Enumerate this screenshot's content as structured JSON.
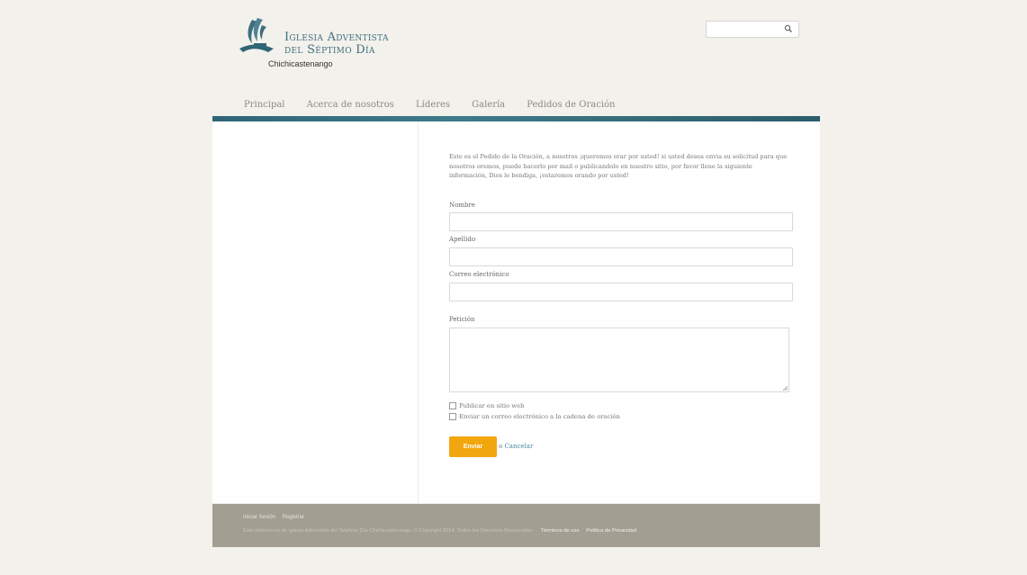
{
  "header": {
    "logo_line1": "Iglesia Adventista",
    "logo_line2": "del Séptimo Día",
    "logo_sub": "Chichicastenango",
    "search_placeholder": "",
    "search_icon": "search-icon"
  },
  "nav": {
    "items": [
      {
        "label": "Principal"
      },
      {
        "label": "Acerca de nosotros"
      },
      {
        "label": "Líderes"
      },
      {
        "label": "Galería"
      },
      {
        "label": "Pedidos de Oración"
      }
    ]
  },
  "form": {
    "intro": "Este es el Pedido de la Oración, a nosotros ¡queremos orar por usted! si usted desea envia su solicitud para que nosotros oremos, puede hacerlo por mail o publicandolo en nuestro sitio, por favor llene la siguiente información, Dios le bendiga, ¡estaremos orando por usted!",
    "fields": [
      {
        "label": "Nombre",
        "value": ""
      },
      {
        "label": "Apellido",
        "value": ""
      },
      {
        "label": "Correo electrónico",
        "value": ""
      }
    ],
    "peticion_label": "Petición",
    "peticion_value": "",
    "checkboxes": [
      {
        "label": "Publicar en sitio web",
        "checked": false
      },
      {
        "label": "Enviar un correo electrónico a la cadena de oración",
        "checked": false
      }
    ],
    "submit_label": "Enviar",
    "cancel_prefix": "o",
    "cancel_label": "Cancelar"
  },
  "footer": {
    "links": [
      "Iniciar Sesión",
      "Registrar"
    ],
    "copyright": "Este sistema es de Iglesia Adventista del Séptimo Día Chichicastenango. © Copyright 2014. Todos los Derechos Reservados.",
    "terms_label": "Términos de uso",
    "privacy_label": "Política de Privacidad"
  },
  "colors": {
    "accent_teal": "#2f6676",
    "button_orange": "#f2a60d",
    "footer_bg": "#a39e92",
    "page_bg": "#f3f1ec"
  }
}
